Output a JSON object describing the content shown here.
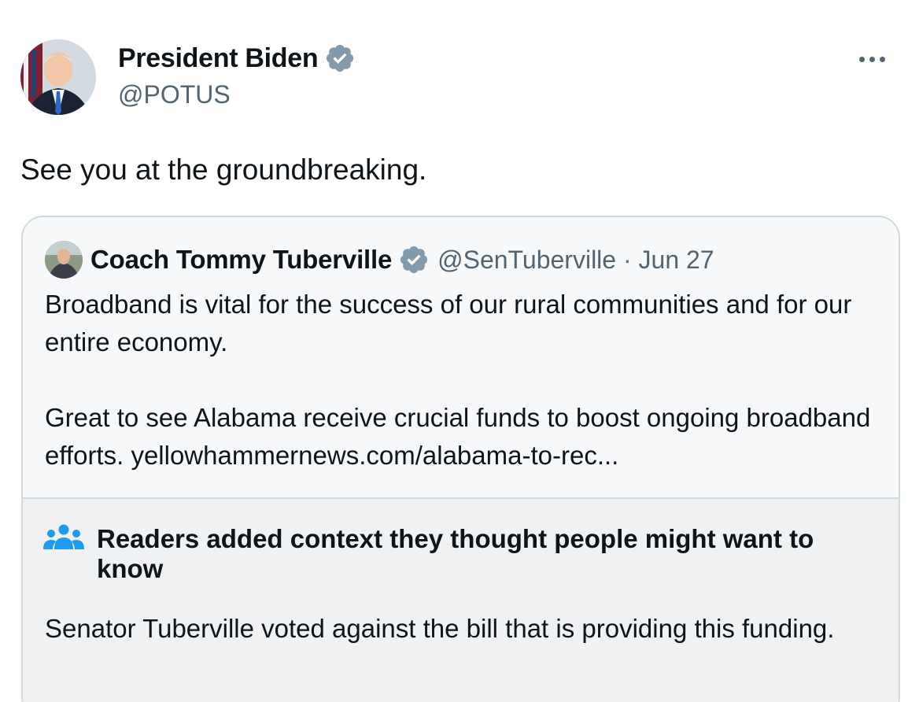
{
  "author": {
    "display_name": "President Biden",
    "handle": "@POTUS",
    "verified_icon": "verified-badge-icon"
  },
  "more_icon": "more-horizontal-icon",
  "tweet": {
    "text": "See you at the groundbreaking."
  },
  "quoted": {
    "display_name": "Coach Tommy Tuberville",
    "meta": "@SenTuberville · Jun 27",
    "paragraph_1": "Broadband is vital for the success of our rural communities and for our entire economy.",
    "paragraph_2": "Great to see Alabama receive crucial funds to boost ongoing broadband efforts. yellowhammernews.com/alabama-to-rec..."
  },
  "community_note": {
    "icon": "people-icon",
    "title": "Readers added context they thought people might want to know",
    "text": "Senator Tuberville voted against the bill that is providing this funding."
  },
  "colors": {
    "text_primary": "#0f1419",
    "text_secondary": "#536471",
    "badge": "#829aab",
    "community_icon": "#1d9bf0",
    "card_border": "#cfd9de"
  }
}
